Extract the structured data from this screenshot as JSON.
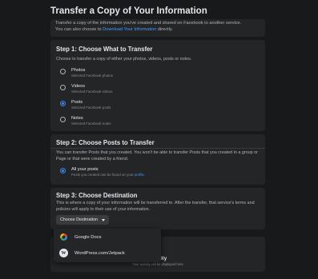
{
  "page": {
    "title": "Transfer a Copy of Your Information"
  },
  "intro": {
    "text_line1": "Transfer a copy of the information you've created and shared on Facebook to another service.",
    "text_line2_prefix": "You can also choose to ",
    "link": "Download Your Information",
    "text_line2_suffix": " directly."
  },
  "step1": {
    "title": "Step 1: Choose What to Transfer",
    "description": "Choose to transfer a copy of either your photos, videos, posts or notes.",
    "options": [
      {
        "label": "Photos",
        "sub": "Selected Facebook photos",
        "selected": false
      },
      {
        "label": "Videos",
        "sub": "Selected Facebook videos",
        "selected": false
      },
      {
        "label": "Posts",
        "sub": "Selected Facebook posts",
        "selected": true
      },
      {
        "label": "Notes",
        "sub": "Selected Facebook notes",
        "selected": false
      }
    ]
  },
  "step2": {
    "title": "Step 2: Choose Posts to Transfer",
    "description": "You can transfer Posts that you created. You won't be able to transfer Posts that you created in a group or Page or that were created by a friend.",
    "option": {
      "label": "All your posts",
      "sub_prefix": "Posts you created can be found on your ",
      "sub_link": "profile",
      "sub_suffix": ".",
      "selected": true
    }
  },
  "step3": {
    "title": "Step 3: Choose Destination",
    "description": "This is where a copy of your information will be transferred to. After the transfer, that service's terms and policies will apply to their use of your information.",
    "button_label": "Choose Destination"
  },
  "dropdown": {
    "items": [
      {
        "label": "Google Docs",
        "icon": "google-docs-icon"
      },
      {
        "label": "WordPress.com/Jetpack",
        "icon": "wordpress-icon"
      }
    ]
  },
  "activity": {
    "title": "Activity",
    "subtitle": "Your activity will be displayed here"
  },
  "colors": {
    "background": "#18191a",
    "card": "#242526",
    "accent": "#2d88ff",
    "link": "#4599ff"
  }
}
